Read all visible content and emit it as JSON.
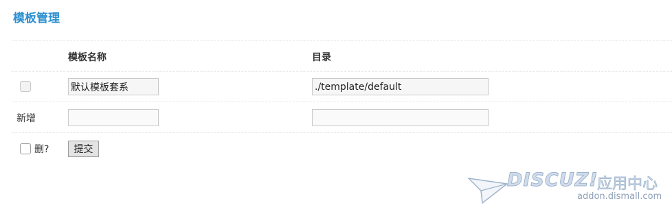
{
  "page": {
    "title": "模板管理"
  },
  "table": {
    "headers": {
      "name": "模板名称",
      "directory": "目录"
    },
    "rows": [
      {
        "name_value": "默认模板套系",
        "directory_value": "./template/default",
        "checkbox_disabled": true
      }
    ],
    "new_row": {
      "label": "新增",
      "name_value": "",
      "directory_value": ""
    }
  },
  "footer": {
    "delete_label": "删?",
    "submit_label": "提交"
  },
  "watermark": {
    "logo": "DISCUZ!",
    "subtitle": "应用中心",
    "url": "addon.dismall.com"
  }
}
